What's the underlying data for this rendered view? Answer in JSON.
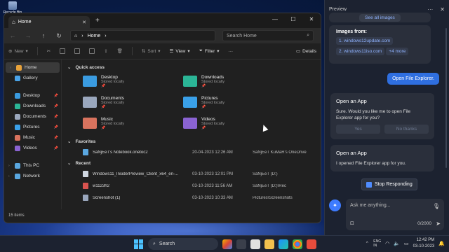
{
  "desktop": {
    "recycle_bin": "Recycle Bin"
  },
  "explorer": {
    "tab_title": "Home",
    "address": {
      "crumb": "Home"
    },
    "search": {
      "placeholder": "Search Home"
    },
    "toolbar": {
      "new": "New",
      "sort": "Sort",
      "view": "View",
      "filter": "Filter",
      "more": "···",
      "details": "Details"
    },
    "sidebar": {
      "home": "Home",
      "gallery": "Gallery",
      "desktop": "Desktop",
      "downloads": "Downloads",
      "documents": "Documents",
      "pictures": "Pictures",
      "music": "Music",
      "videos": "Videos",
      "this_pc": "This PC",
      "network": "Network"
    },
    "quick_access": {
      "header": "Quick access",
      "items": [
        {
          "name": "Desktop",
          "sub": "Stored locally",
          "color": "#3a9be0"
        },
        {
          "name": "Downloads",
          "sub": "Stored locally",
          "color": "#2bb596"
        },
        {
          "name": "Documents",
          "sub": "Stored locally",
          "color": "#9aa7bd"
        },
        {
          "name": "Pictures",
          "sub": "Stored locally",
          "color": "#3aa0e8"
        },
        {
          "name": "Music",
          "sub": "Stored locally",
          "color": "#d9735e"
        },
        {
          "name": "Videos",
          "sub": "Stored locally",
          "color": "#8a63d2"
        }
      ]
    },
    "favorites": {
      "header": "Favorites",
      "rows": [
        {
          "name": "SaNjEeT's Notebook.onetoc2",
          "date": "20-04-2023 12:26 AM",
          "location": "SaNjEeT KuMaR's OneDrive"
        }
      ]
    },
    "recent": {
      "header": "Recent",
      "rows": [
        {
          "name": "Windows11_InsiderPreview_Client_x64_en-...",
          "date": "03-10-2023 12:01 PM",
          "location": "SaNjEeT (D:)"
        },
        {
          "name": "w1123h2",
          "date": "03-10-2023 11:56 AM",
          "location": "SaNjEeT (D:)\\Rec"
        },
        {
          "name": "Screenshot (1)",
          "date": "03-10-2023 10:33 AM",
          "location": "Pictures\\Screenshots"
        }
      ]
    },
    "status": "15 items"
  },
  "copilot": {
    "title": "Preview",
    "see_all": "See all images",
    "images_from": "Images from:",
    "links": [
      "1. windows12update.com",
      "2. windows11iso.com",
      "+4 more"
    ],
    "user_msg": "Open File Explorer.",
    "card1": {
      "heading": "Open an App",
      "text": "Sure. Would you like me to open File Explorer app for you?",
      "yes": "Yes",
      "no": "No thanks"
    },
    "card2": {
      "heading": "Open an App",
      "text": "I opened File Explorer app for you."
    },
    "stop": "Stop Responding",
    "input_placeholder": "Ask me anything...",
    "counter": "0/2000"
  },
  "taskbar": {
    "search": "Search",
    "lang": "ENG\nIN",
    "time": "12:42 PM",
    "date": "03-10-2023"
  },
  "colors": {
    "accent": "#2f6fe0",
    "link": "#8fb3ff"
  }
}
